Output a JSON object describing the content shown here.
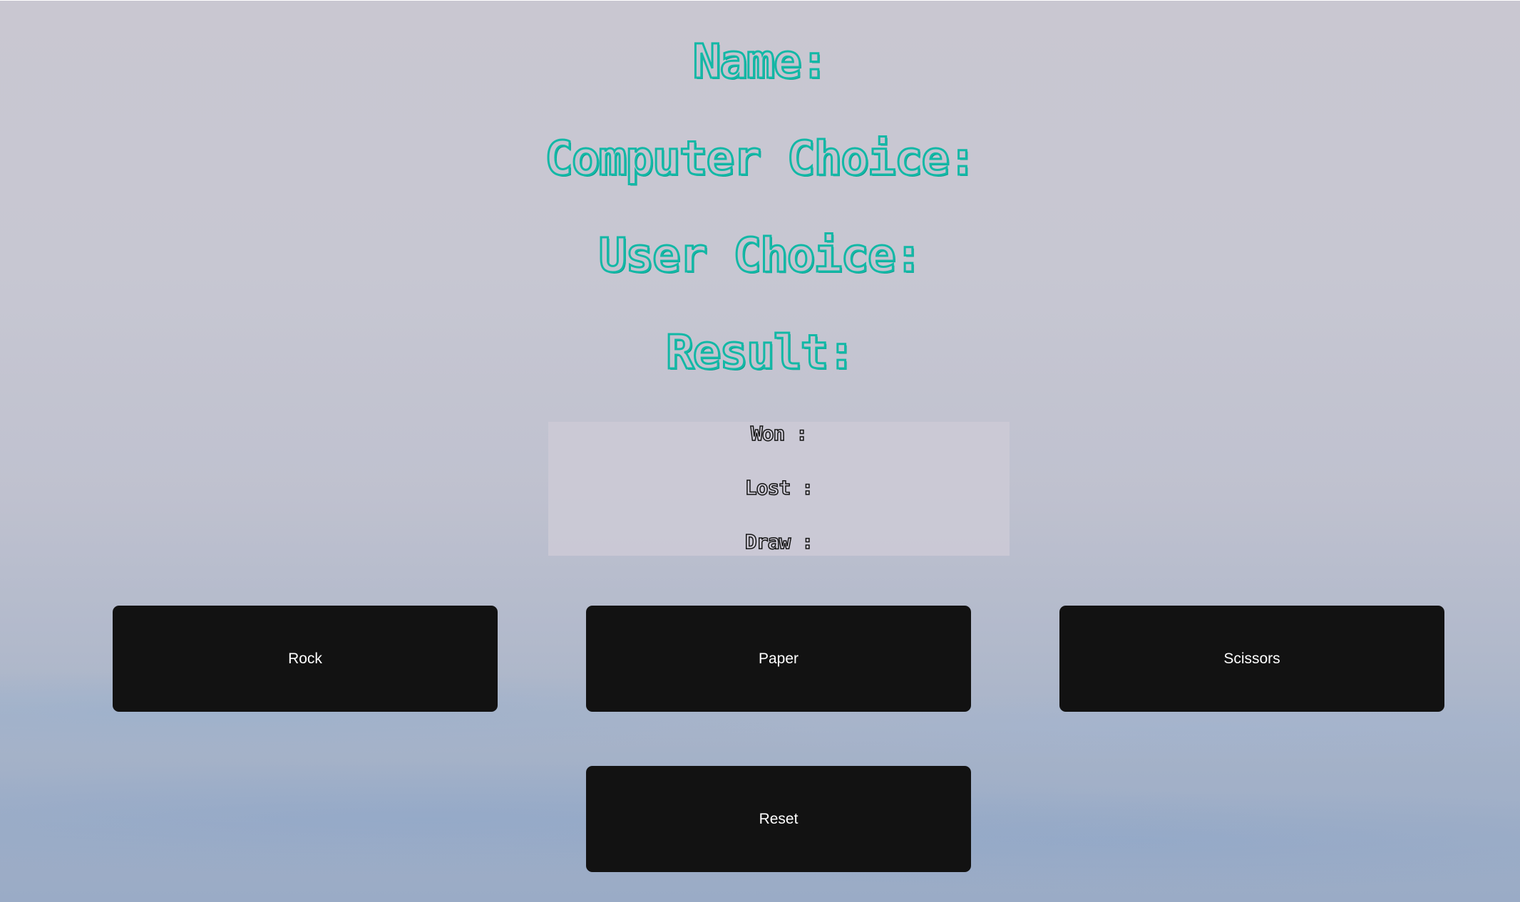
{
  "status": {
    "name_label": "Name:",
    "computer_choice_label": "Computer Choice:",
    "user_choice_label": "User Choice:",
    "result_label": "Result:"
  },
  "score": {
    "won_label": "Won :",
    "lost_label": "Lost :",
    "draw_label": "Draw :"
  },
  "controls": {
    "rock_label": "Rock",
    "paper_label": "Paper",
    "scissors_label": "Scissors",
    "reset_label": "Reset"
  },
  "colors": {
    "heading_outline": "#12b8a6",
    "button_background": "#121212",
    "button_text": "#ffffff"
  }
}
